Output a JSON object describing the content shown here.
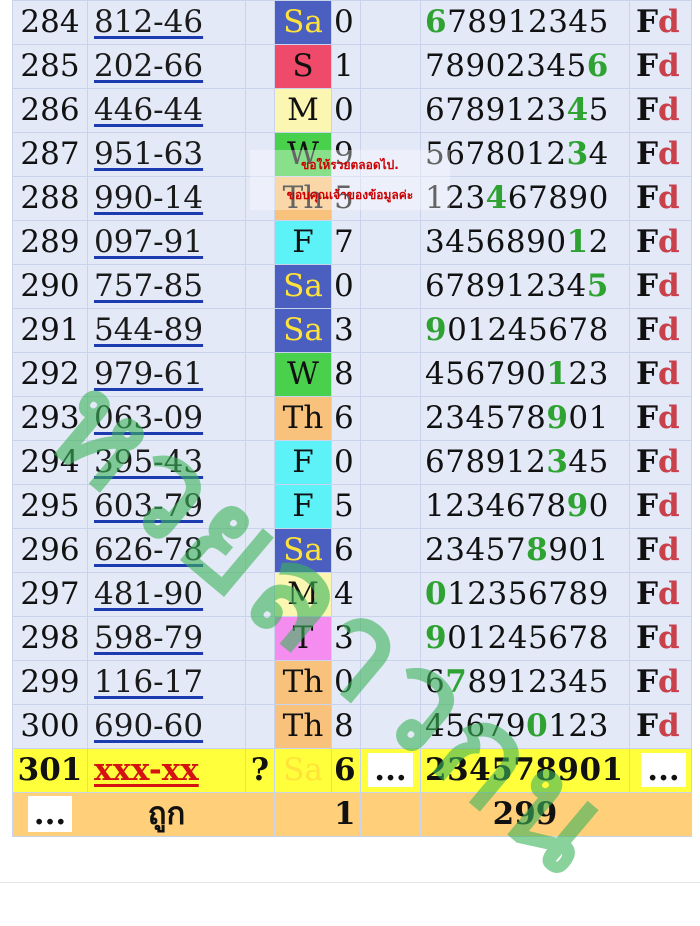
{
  "rows": [
    {
      "idx": "284",
      "num": "812-46",
      "day": "Sa",
      "day_color": "#4a5fc0",
      "digit": "0",
      "seq_pre": "",
      "seq_hi": "6",
      "seq_post": "78912345",
      "fd_f": "F",
      "fd_d": "d"
    },
    {
      "idx": "285",
      "num": "202-66",
      "day": "S",
      "day_color": "#f04a6a",
      "digit": "1",
      "seq_pre": "78902345",
      "seq_hi": "6",
      "seq_post": "",
      "fd_f": "F",
      "fd_d": "d"
    },
    {
      "idx": "286",
      "num": "446-44",
      "day": "M",
      "day_color": "#fbf7b2",
      "digit": "0",
      "seq_pre": "6789123",
      "seq_hi": "4",
      "seq_post": "5",
      "fd_f": "F",
      "fd_d": "d"
    },
    {
      "idx": "287",
      "num": "951-63",
      "day": "W",
      "day_color": "#49d04d",
      "digit": "9",
      "seq_pre": "5678012",
      "seq_hi": "3",
      "seq_post": "4",
      "fd_f": "F",
      "fd_d": "d"
    },
    {
      "idx": "288",
      "num": "990-14",
      "day": "Th",
      "day_color": "#f8c27c",
      "digit": "5",
      "seq_pre": "123",
      "seq_hi": "4",
      "seq_post": "67890",
      "fd_f": "F",
      "fd_d": "d"
    },
    {
      "idx": "289",
      "num": "097-91",
      "day": "F",
      "day_color": "#5df2f8",
      "digit": "7",
      "seq_pre": "3456890",
      "seq_hi": "1",
      "seq_post": "2",
      "fd_f": "F",
      "fd_d": "d"
    },
    {
      "idx": "290",
      "num": "757-85",
      "day": "Sa",
      "day_color": "#4a5fc0",
      "digit": "0",
      "seq_pre": "67891234",
      "seq_hi": "5",
      "seq_post": "",
      "fd_f": "F",
      "fd_d": "d"
    },
    {
      "idx": "291",
      "num": "544-89",
      "day": "Sa",
      "day_color": "#4a5fc0",
      "digit": "3",
      "seq_pre": "",
      "seq_hi": "9",
      "seq_post": "01245678",
      "fd_f": "F",
      "fd_d": "d"
    },
    {
      "idx": "292",
      "num": "979-61",
      "day": "W",
      "day_color": "#49d04d",
      "digit": "8",
      "seq_pre": "456790",
      "seq_hi": "1",
      "seq_post": "23",
      "fd_f": "F",
      "fd_d": "d"
    },
    {
      "idx": "293",
      "num": "063-09",
      "day": "Th",
      "day_color": "#f8c27c",
      "digit": "6",
      "seq_pre": "234578",
      "seq_hi": "9",
      "seq_post": "01",
      "fd_f": "F",
      "fd_d": "d"
    },
    {
      "idx": "294",
      "num": "395-43",
      "day": "F",
      "day_color": "#5df2f8",
      "digit": "0",
      "seq_pre": "678912",
      "seq_hi": "3",
      "seq_post": "45",
      "fd_f": "F",
      "fd_d": "d"
    },
    {
      "idx": "295",
      "num": "603-79",
      "day": "F",
      "day_color": "#5df2f8",
      "digit": "5",
      "seq_pre": "1234678",
      "seq_hi": "9",
      "seq_post": "0",
      "fd_f": "F",
      "fd_d": "d"
    },
    {
      "idx": "296",
      "num": "626-78",
      "day": "Sa",
      "day_color": "#4a5fc0",
      "digit": "6",
      "seq_pre": "23457",
      "seq_hi": "8",
      "seq_post": "901",
      "fd_f": "F",
      "fd_d": "d"
    },
    {
      "idx": "297",
      "num": "481-90",
      "day": "M",
      "day_color": "#fbf7b2",
      "digit": "4",
      "seq_pre": "",
      "seq_hi": "0",
      "seq_post": "12356789",
      "fd_f": "F",
      "fd_d": "d"
    },
    {
      "idx": "298",
      "num": "598-79",
      "day": "T",
      "day_color": "#f58cf0",
      "digit": "3",
      "seq_pre": "",
      "seq_hi": "9",
      "seq_post": "01245678",
      "fd_f": "F",
      "fd_d": "d"
    },
    {
      "idx": "299",
      "num": "116-17",
      "day": "Th",
      "day_color": "#f8c27c",
      "digit": "0",
      "seq_pre": "6",
      "seq_hi": "7",
      "seq_post": "8912345",
      "fd_f": "F",
      "fd_d": "d"
    },
    {
      "idx": "300",
      "num": "690-60",
      "day": "Th",
      "day_color": "#f8c27c",
      "digit": "8",
      "seq_pre": "45679",
      "seq_hi": "0",
      "seq_post": "123",
      "fd_f": "F",
      "fd_d": "d"
    }
  ],
  "current": {
    "idx": "301",
    "num": "xxx-xx",
    "mark": "?",
    "day": "Sa",
    "day_color": "#4a5fc0",
    "digit": "6",
    "gap": "...",
    "seq": "234578901",
    "fd": "..."
  },
  "footer": {
    "idx": "...",
    "label": "ถูก",
    "count": "1",
    "total": "299"
  },
  "notice": {
    "line1": "ขอให้รวยตลอดไป.",
    "line2": "ขอบคุณเจ้าของข้อมูลค่ะ"
  },
  "watermark": "หวยลาวกน"
}
